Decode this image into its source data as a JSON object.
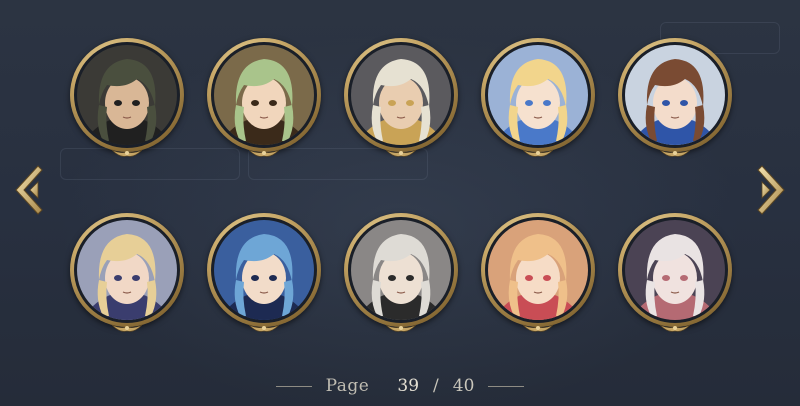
{
  "pagination": {
    "label": "Page",
    "current": "39",
    "separator": "/",
    "total": "40"
  },
  "navigation": {
    "prev_icon": "chevron-left-icon",
    "next_icon": "chevron-right-icon"
  },
  "colors": {
    "frame_gold": "#c6a666",
    "background": "#2a3240"
  },
  "portraits": [
    {
      "name": "portrait-1",
      "hair": "#4a4f3e",
      "skin": "#d9b796",
      "bg": "#3b3a36",
      "accent": "#202020"
    },
    {
      "name": "portrait-2",
      "hair": "#a9c48b",
      "skin": "#f1d6bc",
      "bg": "#7b6a4a",
      "accent": "#3b2a1a"
    },
    {
      "name": "portrait-3",
      "hair": "#e6e1d2",
      "skin": "#e9cdb0",
      "bg": "#5b5a5e",
      "accent": "#c9a356"
    },
    {
      "name": "portrait-4",
      "hair": "#f2d58c",
      "skin": "#f6e1cf",
      "bg": "#9bb2d6",
      "accent": "#4a79c9"
    },
    {
      "name": "portrait-5",
      "hair": "#7a4b33",
      "skin": "#f3dccb",
      "bg": "#c9d3e0",
      "accent": "#2f55a8"
    },
    {
      "name": "portrait-6",
      "hair": "#e7cf97",
      "skin": "#f1d8c6",
      "bg": "#9aa0b8",
      "accent": "#3a3d6e"
    },
    {
      "name": "portrait-7",
      "hair": "#6ea6d6",
      "skin": "#f2dcc9",
      "bg": "#3a5f9e",
      "accent": "#1d2a52"
    },
    {
      "name": "portrait-8",
      "hair": "#dedbd5",
      "skin": "#ede0d3",
      "bg": "#8a8786",
      "accent": "#2b2b2b"
    },
    {
      "name": "portrait-9",
      "hair": "#efc08a",
      "skin": "#f6dcc6",
      "bg": "#d9a27a",
      "accent": "#c94d55"
    },
    {
      "name": "portrait-10",
      "hair": "#e9e3e3",
      "skin": "#f0e2df",
      "bg": "#4b4354",
      "accent": "#b56a73"
    }
  ]
}
